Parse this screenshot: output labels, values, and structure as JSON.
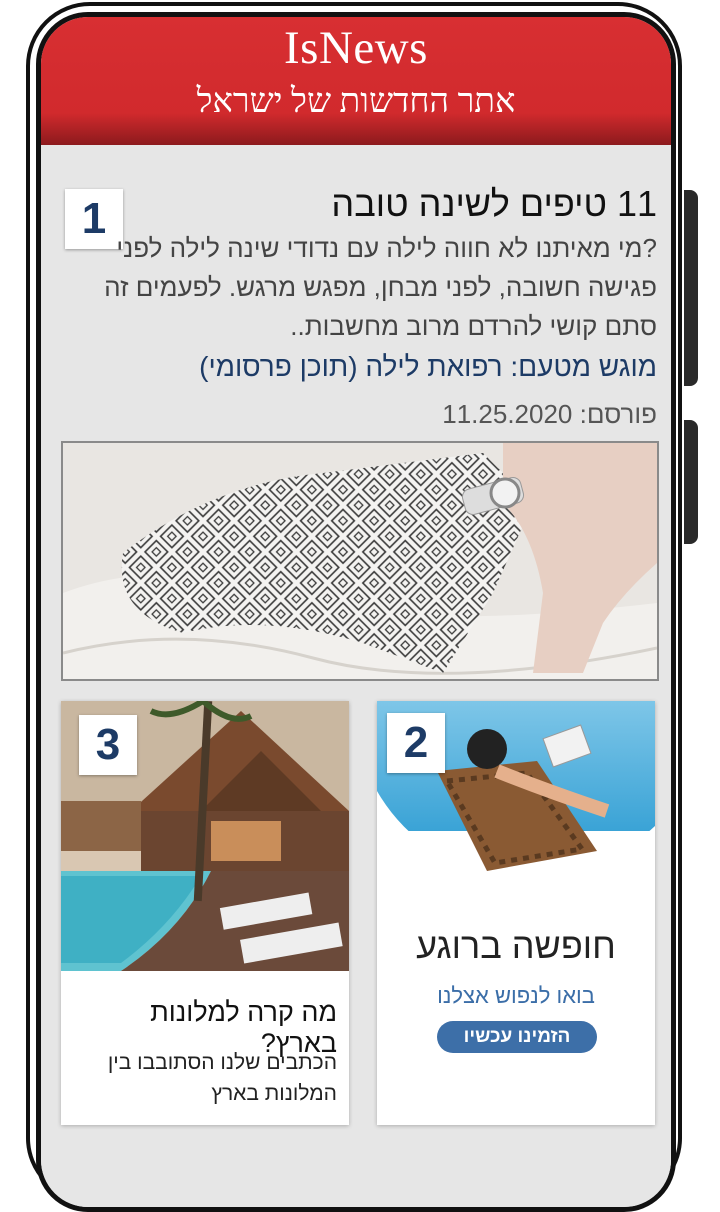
{
  "header": {
    "brand": "IsNews",
    "tagline": "אתר החדשות של ישראל"
  },
  "article1": {
    "rank": "1",
    "title": "11 טיפים לשינה טובה",
    "excerpt": "?מי מאיתנו לא חווה לילה עם נדודי שינה לילה לפני פגישה חשובה, לפני מבחן, מפגש מרגש. לפעמים זה סתם קושי להרדם מרוב מחשבות..",
    "sponsor": "מוגש מטעם: רפואת לילה (תוכן פרסומי)",
    "date": "פורסם: 11.25.2020"
  },
  "card2": {
    "rank": "2",
    "title": "חופשה ברוגע",
    "subtitle": "בואו לנפוש אצלנו",
    "button_label": "הזמינו עכשיו"
  },
  "card3": {
    "rank": "3",
    "title": "מה קרה למלונות בארץ?",
    "text": "הכתבים שלנו הסתובבו בין המלונות בארץ"
  },
  "colors": {
    "header_red": "#d12a2d",
    "badge_navy": "#1d3b66",
    "link_blue": "#3b6ea8",
    "button_blue": "#3d6fa8"
  }
}
